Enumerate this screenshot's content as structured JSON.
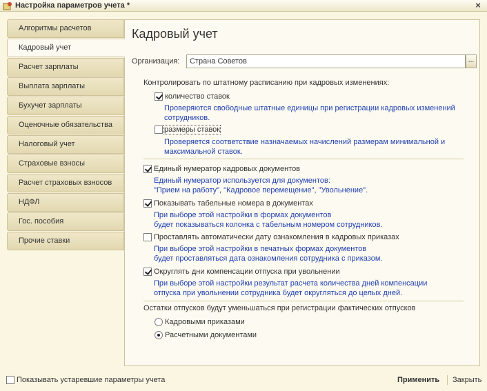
{
  "window": {
    "title": "Настройка параметров учета *",
    "close_glyph": "×"
  },
  "tabs": [
    {
      "label": "Алгоритмы расчетов",
      "active": false
    },
    {
      "label": "Кадровый учет",
      "active": true
    },
    {
      "label": "Расчет зарплаты",
      "active": false
    },
    {
      "label": "Выплата зарплаты",
      "active": false
    },
    {
      "label": "Бухучет зарплаты",
      "active": false
    },
    {
      "label": "Оценочные обязательства",
      "active": false
    },
    {
      "label": "Налоговый учет",
      "active": false
    },
    {
      "label": "Страховые взносы",
      "active": false
    },
    {
      "label": "Расчет страховых взносов",
      "active": false
    },
    {
      "label": "НДФЛ",
      "active": false
    },
    {
      "label": "Гос. пособия",
      "active": false
    },
    {
      "label": "Прочие ставки",
      "active": false
    }
  ],
  "panel": {
    "heading": "Кадровый учет",
    "org_label": "Организация:",
    "org_value": "Страна Советов",
    "org_button": "...",
    "control_heading": "Контролировать по штатному расписанию при кадровых изменениях:",
    "count_rates": {
      "label": "количество ставок",
      "checked": true,
      "hint1": "Проверяются свободные штатные единицы при регистрации кадровых изменений",
      "hint2": "сотрудников."
    },
    "rate_sizes": {
      "label": "размеры ставок",
      "checked": false,
      "hint1": "Проверяется соответствие назначаемых начислений размерам минимальной и",
      "hint2": "максимальной ставок."
    },
    "single_numerator": {
      "label": "Единый нумератор кадровых документов",
      "checked": true,
      "hint1": "Единый нумератор используется для документов:",
      "hint2": "\"Прием на работу\", \"Кадровое перемещение\", \"Увольнение\"."
    },
    "show_personnel_numbers": {
      "label": "Показывать табельные номера в документах",
      "checked": true,
      "hint1": "При выборе этой настройки в формах документов",
      "hint2": "будет показываться колонка с табельным номером сотрудников."
    },
    "auto_ack_date": {
      "label": "Проставлять автоматически дату ознакомления в кадровых приказах",
      "checked": false,
      "hint1": "При выборе этой настройки в печатных формах документов",
      "hint2": "будет проставляться дата ознакомления сотрудника с приказом."
    },
    "round_vacation_days": {
      "label": "Округлять дни компенсации отпуска при увольнении",
      "checked": true,
      "hint1": "При выборе этой настройки результат расчета количества дней компенсации",
      "hint2": "отпуска при увольнении сотрудника будет округляться до целых дней."
    },
    "vacation_heading": "Остатки отпусков будут уменьшаться при регистрации фактических отпусков",
    "radio_orders": {
      "label": "Кадровыми приказами",
      "checked": false
    },
    "radio_docs": {
      "label": "Расчетными документами",
      "checked": true
    }
  },
  "bottom": {
    "show_old_label": "Показывать устаревшие параметры учета",
    "show_old_checked": false,
    "apply_label": "Применить",
    "close_label": "Закрыть"
  }
}
